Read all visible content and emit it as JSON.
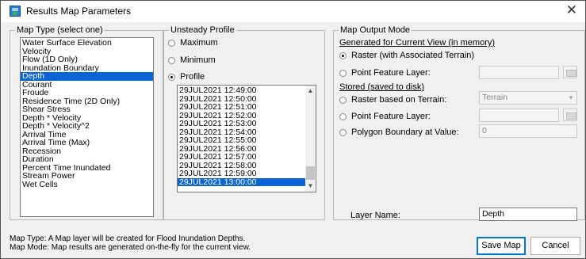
{
  "window": {
    "title": "Results Map Parameters",
    "close_glyph": "✕"
  },
  "map_type": {
    "legend": "Map Type (select one)",
    "selected_index": 4,
    "items": [
      "Water Surface Elevation",
      "Velocity",
      "Flow (1D Only)",
      "Inundation Boundary",
      "Depth",
      "Courant",
      "Froude",
      "Residence Time (2D Only)",
      "Shear Stress",
      "Depth * Velocity",
      "Depth * Velocity^2",
      "Arrival Time",
      "Arrival Time (Max)",
      "Recession",
      "Duration",
      "Percent Time Inundated",
      "Stream Power",
      "Wet Cells"
    ]
  },
  "unsteady": {
    "legend": "Unsteady Profile",
    "maximum": "Maximum",
    "minimum": "Minimum",
    "profile": "Profile",
    "selected_option": "profile",
    "selected_time_index": 11,
    "times": [
      "29JUL2021 12:49:00",
      "29JUL2021 12:50:00",
      "29JUL2021 12:51:00",
      "29JUL2021 12:52:00",
      "29JUL2021 12:53:00",
      "29JUL2021 12:54:00",
      "29JUL2021 12:55:00",
      "29JUL2021 12:56:00",
      "29JUL2021 12:57:00",
      "29JUL2021 12:58:00",
      "29JUL2021 12:59:00",
      "29JUL2021 13:00:00"
    ]
  },
  "output": {
    "legend": "Map Output Mode",
    "generated_header": "Generated for Current View (in memory)",
    "raster_assoc": "Raster (with Associated Terrain)",
    "point_feature_1": "Point Feature Layer:",
    "stored_header": "Stored (saved to disk)",
    "raster_terrain": "Raster based on Terrain:",
    "terrain_value": "Terrain",
    "point_feature_2": "Point Feature Layer:",
    "polygon_boundary": "Polygon Boundary at Value:",
    "polygon_value": "0",
    "layer_name_label": "Layer Name:",
    "layer_name_value": "Depth",
    "selected": "raster_assoc"
  },
  "footer": {
    "line1": "Map Type: A Map layer will be created for Flood Inundation Depths.",
    "line2": "Map Mode: Map results are generated on-the-fly for the current view."
  },
  "buttons": {
    "save": "Save Map",
    "cancel": "Cancel"
  },
  "icons": {
    "folder": "folder-open-icon",
    "dropdown": "chevron-down-icon",
    "app": "results-map-icon"
  }
}
